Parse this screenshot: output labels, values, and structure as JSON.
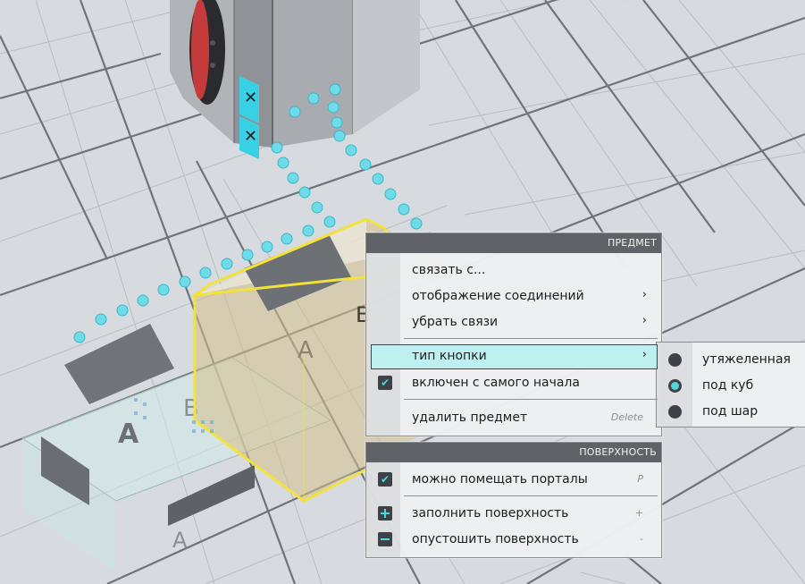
{
  "object_menu": {
    "header": "ПРЕДМЕТ",
    "items": [
      {
        "label": "связать с...",
        "has_submenu": false
      },
      {
        "label": "отображение соединений",
        "has_submenu": true
      },
      {
        "label": "убрать связи",
        "has_submenu": true
      },
      {
        "label": "тип кнопки",
        "has_submenu": true,
        "highlighted": true
      },
      {
        "label": "включен с самого начала",
        "checked": true
      },
      {
        "label": "удалить предмет",
        "shortcut": "Delete"
      }
    ]
  },
  "surface_menu": {
    "header": "ПОВЕРХНОСТЬ",
    "items": [
      {
        "label": "можно помещать порталы",
        "checked": true,
        "shortcut": "P"
      },
      {
        "label": "заполнить поверхность",
        "icon": "plus-icon",
        "shortcut": "+"
      },
      {
        "label": "опустошить поверхность",
        "icon": "minus-icon",
        "shortcut": "-"
      }
    ]
  },
  "button_type_submenu": {
    "selected": "под куб",
    "options": [
      {
        "label": "утяжеленная",
        "selected": false
      },
      {
        "label": "под куб",
        "selected": true
      },
      {
        "label": "под шар",
        "selected": false
      }
    ]
  },
  "scene": {
    "button_labels": [
      "A",
      "B",
      "A",
      "B"
    ],
    "colors": {
      "floor": "#d9dde1",
      "grid": "#6f747a",
      "highlight_outline": "#f2e23a",
      "connection_dots": "#6fdbe8",
      "menu_header": "#5f6266",
      "menu_highlight": "#bff0f1",
      "accent": "#4fd7db"
    }
  }
}
